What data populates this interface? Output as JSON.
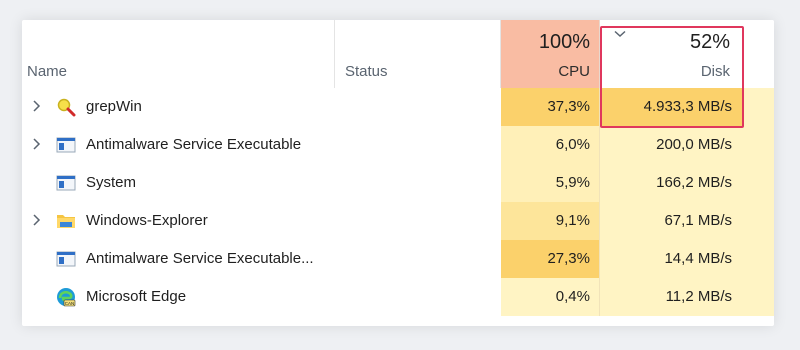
{
  "header": {
    "name_label": "Name",
    "status_label": "Status",
    "cpu_total": "100%",
    "cpu_label": "CPU",
    "disk_total": "52%",
    "disk_label": "Disk"
  },
  "colors": {
    "cpu_header": "#f9bca3",
    "cell_light": "#fff4c4",
    "cell_medium": "#fde59a",
    "cell_hot": "#fbd16b",
    "highlight_border": "#e0375d"
  },
  "processes": [
    {
      "name": "grepWin",
      "icon": "magnifier-icon",
      "expandable": true,
      "cpu": "37,3%",
      "disk": "4.933,3 MB/s",
      "cpu_color": "#fbd16b",
      "disk_color": "#fbd16b"
    },
    {
      "name": "Antimalware Service Executable",
      "icon": "app-window-icon",
      "expandable": true,
      "cpu": "6,0%",
      "disk": "200,0 MB/s",
      "cpu_color": "#fff0b8",
      "disk_color": "#fff4c4"
    },
    {
      "name": "System",
      "icon": "app-window-icon",
      "expandable": false,
      "cpu": "5,9%",
      "disk": "166,2 MB/s",
      "cpu_color": "#fff0b8",
      "disk_color": "#fff4c4"
    },
    {
      "name": "Windows-Explorer",
      "icon": "folder-icon",
      "expandable": true,
      "cpu": "9,1%",
      "disk": "67,1 MB/s",
      "cpu_color": "#fde59a",
      "disk_color": "#fff4c4"
    },
    {
      "name": "Antimalware Service Executable...",
      "icon": "app-window-icon",
      "expandable": false,
      "cpu": "27,3%",
      "disk": "14,4 MB/s",
      "cpu_color": "#fbd16b",
      "disk_color": "#fff4c4"
    },
    {
      "name": "Microsoft Edge",
      "icon": "edge-browser-icon",
      "expandable": false,
      "cpu": "0,4%",
      "disk": "11,2 MB/s",
      "cpu_color": "#fff4c4",
      "disk_color": "#fff4c4"
    }
  ]
}
